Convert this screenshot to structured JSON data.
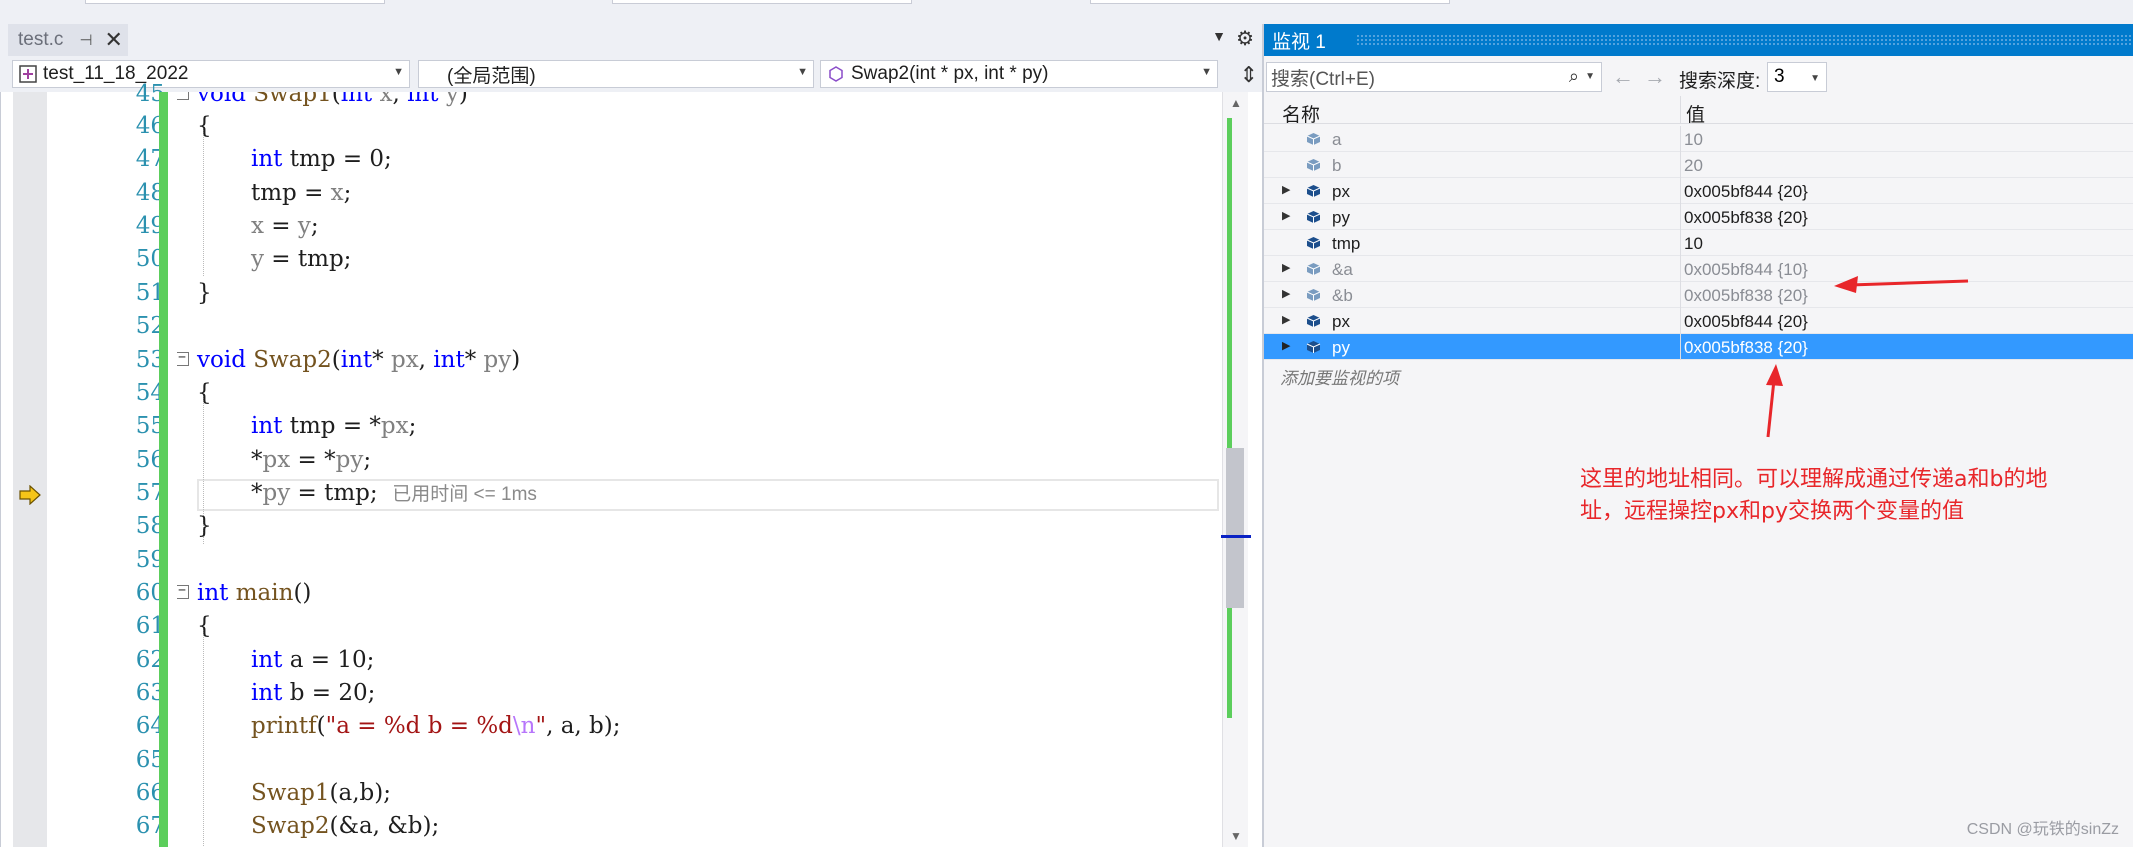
{
  "editor": {
    "tab_label": "test.c",
    "pin_glyph": "⊣",
    "close_glyph": "✕",
    "nav": {
      "project": "test_11_18_2022",
      "scope": "(全局范围)",
      "function": "Swap2(int * px, int * py)"
    },
    "perf_tip": "已用时间 <= 1ms",
    "line_numbers": [
      "45",
      "46",
      "47",
      "48",
      "49",
      "50",
      "51",
      "52",
      "53",
      "54",
      "55",
      "56",
      "57",
      "58",
      "59",
      "60",
      "61",
      "62",
      "63",
      "64",
      "65",
      "66",
      "67"
    ]
  },
  "watch": {
    "title": "监视 1",
    "search_placeholder": "搜索(Ctrl+E)",
    "depth_label": "搜索深度:",
    "depth_value": "3",
    "col_name": "名称",
    "col_value": "值",
    "rows": [
      {
        "name": "a",
        "value": "10",
        "expandable": false,
        "state": "stale"
      },
      {
        "name": "b",
        "value": "20",
        "expandable": false,
        "state": "stale"
      },
      {
        "name": "px",
        "value": "0x005bf844 {20}",
        "expandable": true,
        "state": "live"
      },
      {
        "name": "py",
        "value": "0x005bf838 {20}",
        "expandable": true,
        "state": "live"
      },
      {
        "name": "tmp",
        "value": "10",
        "expandable": false,
        "state": "live"
      },
      {
        "name": "&a",
        "value": "0x005bf844 {10}",
        "expandable": true,
        "state": "stale"
      },
      {
        "name": "&b",
        "value": "0x005bf838 {20}",
        "expandable": true,
        "state": "stale"
      },
      {
        "name": "px",
        "value": "0x005bf844 {20}",
        "expandable": true,
        "state": "live"
      },
      {
        "name": "py",
        "value": "0x005bf838 {20}",
        "expandable": true,
        "state": "selected"
      }
    ],
    "add_watch_hint": "添加要监视的项"
  },
  "annotation": {
    "line1": "这里的地址相同。可以理解成通过传递a和b的地",
    "line2": "址，远程操控px和py交换两个变量的值",
    "color": "#e8262a"
  },
  "watermark": "CSDN @玩铁的sinZz",
  "colors": {
    "accent": "#007acc",
    "selection": "#3399ff",
    "keyword": "#0000ff",
    "function": "#74531f",
    "parameter": "#808080",
    "string": "#a31515",
    "line_number": "#2b91af",
    "change_bar": "#5cce5c"
  },
  "icons": {
    "tab_pin": "pin-icon",
    "tab_close": "close-icon",
    "settings": "gear-icon",
    "search": "search-icon",
    "back": "arrow-left-icon",
    "forward": "arrow-right-icon",
    "variable": "variable-cube-icon",
    "current_statement": "current-statement-arrow-icon"
  }
}
